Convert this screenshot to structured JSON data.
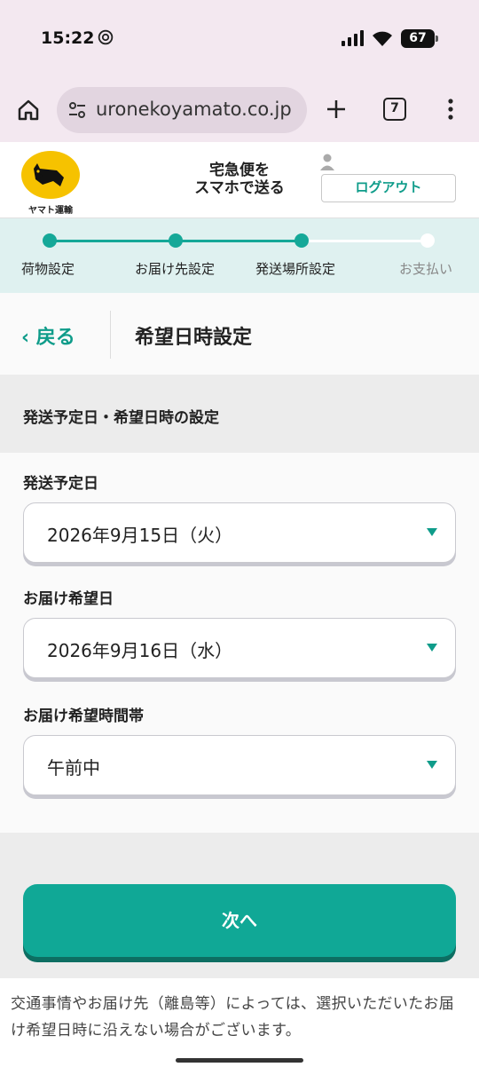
{
  "status_bar": {
    "time": "15:22",
    "battery": "67"
  },
  "browser": {
    "url": "uronekoyamato.co.jp",
    "tab_count": "7"
  },
  "site_header": {
    "logo_text": "ヤマト運輸",
    "tagline_line1": "宅急便を",
    "tagline_line2": "スマホで送る",
    "logout_label": "ログアウト"
  },
  "stepper": {
    "steps": [
      {
        "label": "荷物設定",
        "state": "done"
      },
      {
        "label": "お届け先設定",
        "state": "done"
      },
      {
        "label": "発送場所設定",
        "state": "current"
      },
      {
        "label": "お支払い",
        "state": "todo"
      }
    ],
    "active_color": "#15a898",
    "inactive_color": "#ffffff"
  },
  "title_bar": {
    "back_label": "戻る",
    "title": "希望日時設定"
  },
  "section": {
    "title": "発送予定日・希望日時の設定"
  },
  "form": {
    "ship_date": {
      "label": "発送予定日",
      "value": "2026年9月15日（火）"
    },
    "delivery_date": {
      "label": "お届け希望日",
      "value": "2026年9月16日（水）"
    },
    "delivery_time": {
      "label": "お届け希望時間帯",
      "value": "午前中"
    }
  },
  "next_button": {
    "label": "次へ"
  },
  "note": {
    "text": "交通事情やお届け先（離島等）によっては、選択いただいたお届け希望日時に沿えない場合がございます。"
  },
  "colors": {
    "accent": "#10a896",
    "accent_dark": "#0d6e62",
    "logo_yellow": "#f6c200"
  }
}
